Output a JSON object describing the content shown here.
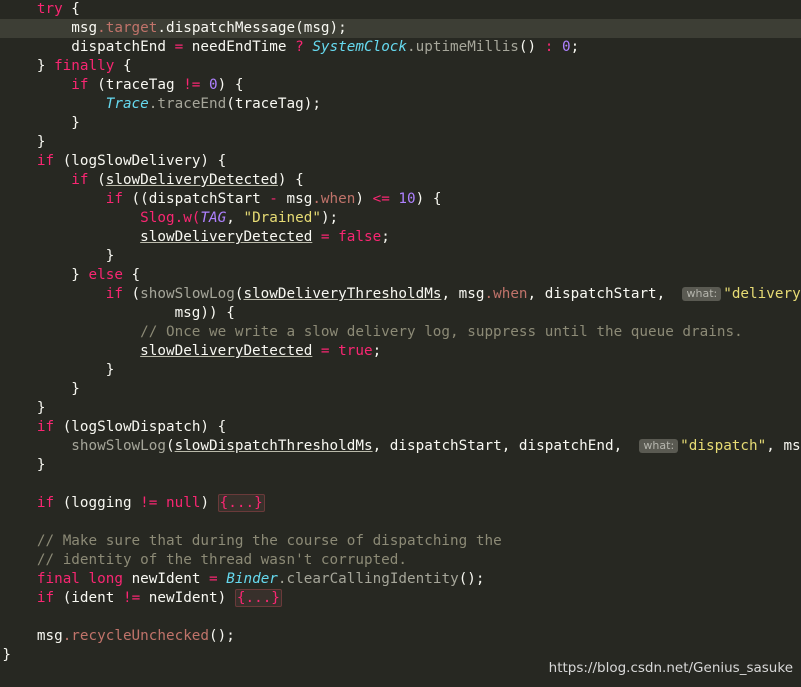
{
  "editor": {
    "language": "Java",
    "colors": {
      "background": "#272822",
      "current_line": "#3d3e35",
      "keyword": "#f92672",
      "number": "#ae81ff",
      "string": "#e6db74",
      "class": "#66d9ef",
      "comment": "#8c8a76",
      "text": "#f8f8f2"
    },
    "lines": [
      {
        "current": false,
        "tokens": [
          {
            "t": "        "
          },
          {
            "t": "try",
            "c": "kw"
          },
          {
            "t": " {"
          }
        ]
      },
      {
        "current": true,
        "tokens": [
          {
            "t": "            msg"
          },
          {
            "t": ".target",
            "c": "mcall"
          },
          {
            "t": ".dispatchMessage(msg);"
          }
        ]
      },
      {
        "current": false,
        "tokens": [
          {
            "t": "            dispatchEnd "
          },
          {
            "t": "=",
            "c": "kw"
          },
          {
            "t": " needEndTime "
          },
          {
            "t": "?",
            "c": "kw"
          },
          {
            "t": " "
          },
          {
            "t": "SystemClock",
            "c": "cls"
          },
          {
            "t": ".uptimeMillis",
            "c": "meth"
          },
          {
            "t": "() "
          },
          {
            "t": ":",
            "c": "kw"
          },
          {
            "t": " "
          },
          {
            "t": "0",
            "c": "num"
          },
          {
            "t": ";"
          }
        ]
      },
      {
        "current": false,
        "tokens": [
          {
            "t": "        } "
          },
          {
            "t": "finally",
            "c": "kw"
          },
          {
            "t": " {"
          }
        ]
      },
      {
        "current": false,
        "tokens": [
          {
            "t": "            "
          },
          {
            "t": "if",
            "c": "kw"
          },
          {
            "t": " (traceTag "
          },
          {
            "t": "!=",
            "c": "kw"
          },
          {
            "t": " "
          },
          {
            "t": "0",
            "c": "num"
          },
          {
            "t": ") {"
          }
        ]
      },
      {
        "current": false,
        "tokens": [
          {
            "t": "                "
          },
          {
            "t": "Trace",
            "c": "cls"
          },
          {
            "t": ".traceEnd",
            "c": "meth"
          },
          {
            "t": "(traceTag);"
          }
        ]
      },
      {
        "current": false,
        "tokens": [
          {
            "t": "            }"
          }
        ]
      },
      {
        "current": false,
        "tokens": [
          {
            "t": "        }"
          }
        ]
      },
      {
        "current": false,
        "tokens": [
          {
            "t": "        "
          },
          {
            "t": "if",
            "c": "kw"
          },
          {
            "t": " (logSlowDelivery) {"
          }
        ]
      },
      {
        "current": false,
        "tokens": [
          {
            "t": "            "
          },
          {
            "t": "if",
            "c": "kw"
          },
          {
            "t": " ("
          },
          {
            "t": "slowDeliveryDetected",
            "c": "ul"
          },
          {
            "t": ") {"
          }
        ]
      },
      {
        "current": false,
        "tokens": [
          {
            "t": "                "
          },
          {
            "t": "if",
            "c": "kw"
          },
          {
            "t": " ((dispatchStart "
          },
          {
            "t": "-",
            "c": "kw"
          },
          {
            "t": " msg"
          },
          {
            "t": ".when",
            "c": "mcall"
          },
          {
            "t": ") "
          },
          {
            "t": "<=",
            "c": "kw"
          },
          {
            "t": " "
          },
          {
            "t": "10",
            "c": "num"
          },
          {
            "t": ") {"
          }
        ]
      },
      {
        "current": false,
        "tokens": [
          {
            "t": "                    "
          },
          {
            "t": "Slog",
            "c": "kw"
          },
          {
            "t": ".w(",
            "c": "kw"
          },
          {
            "t": "TAG",
            "c": "const"
          },
          {
            "t": ", "
          },
          {
            "t": "\"Drained\"",
            "c": "str"
          },
          {
            "t": ");"
          }
        ]
      },
      {
        "current": false,
        "tokens": [
          {
            "t": "                    "
          },
          {
            "t": "slowDeliveryDetected",
            "c": "ul"
          },
          {
            "t": " "
          },
          {
            "t": "=",
            "c": "kw"
          },
          {
            "t": " "
          },
          {
            "t": "false",
            "c": "kw"
          },
          {
            "t": ";"
          }
        ]
      },
      {
        "current": false,
        "tokens": [
          {
            "t": "                }"
          }
        ]
      },
      {
        "current": false,
        "tokens": [
          {
            "t": "            } "
          },
          {
            "t": "else",
            "c": "kw"
          },
          {
            "t": " {"
          }
        ]
      },
      {
        "current": false,
        "tokens": [
          {
            "t": "                "
          },
          {
            "t": "if",
            "c": "kw"
          },
          {
            "t": " ("
          },
          {
            "t": "showSlowLog",
            "c": "meth"
          },
          {
            "t": "("
          },
          {
            "t": "slowDeliveryThresholdMs",
            "c": "ul"
          },
          {
            "t": ", msg"
          },
          {
            "t": ".when",
            "c": "mcall"
          },
          {
            "t": ", dispatchStart,  "
          },
          {
            "t": "what:",
            "c": "hint"
          },
          {
            "t": "\"delivery\"",
            "c": "str"
          },
          {
            "t": ","
          }
        ]
      },
      {
        "current": false,
        "tokens": [
          {
            "t": "                        msg)) {"
          }
        ]
      },
      {
        "current": false,
        "tokens": [
          {
            "t": "                    "
          },
          {
            "t": "// Once we write a slow delivery log, suppress until the queue drains.",
            "c": "cmt"
          }
        ]
      },
      {
        "current": false,
        "tokens": [
          {
            "t": "                    "
          },
          {
            "t": "slowDeliveryDetected",
            "c": "ul"
          },
          {
            "t": " "
          },
          {
            "t": "=",
            "c": "kw"
          },
          {
            "t": " "
          },
          {
            "t": "true",
            "c": "kw"
          },
          {
            "t": ";"
          }
        ]
      },
      {
        "current": false,
        "tokens": [
          {
            "t": "                }"
          }
        ]
      },
      {
        "current": false,
        "tokens": [
          {
            "t": "            }"
          }
        ]
      },
      {
        "current": false,
        "tokens": [
          {
            "t": "        }"
          }
        ]
      },
      {
        "current": false,
        "tokens": [
          {
            "t": "        "
          },
          {
            "t": "if",
            "c": "kw"
          },
          {
            "t": " (logSlowDispatch) {"
          }
        ]
      },
      {
        "current": false,
        "tokens": [
          {
            "t": "            "
          },
          {
            "t": "showSlowLog",
            "c": "meth"
          },
          {
            "t": "("
          },
          {
            "t": "slowDispatchThresholdMs",
            "c": "ul"
          },
          {
            "t": ", dispatchStart, dispatchEnd,  "
          },
          {
            "t": "what:",
            "c": "hint"
          },
          {
            "t": "\"dispatch\"",
            "c": "str"
          },
          {
            "t": ", msg);"
          }
        ]
      },
      {
        "current": false,
        "tokens": [
          {
            "t": "        }"
          }
        ]
      },
      {
        "current": false,
        "tokens": [
          {
            "t": ""
          }
        ]
      },
      {
        "current": false,
        "tokens": [
          {
            "t": "        "
          },
          {
            "t": "if",
            "c": "kw"
          },
          {
            "t": " (logging "
          },
          {
            "t": "!=",
            "c": "kw"
          },
          {
            "t": " "
          },
          {
            "t": "null",
            "c": "kw"
          },
          {
            "t": ") "
          },
          {
            "t": "{...}",
            "c": "fold"
          }
        ]
      },
      {
        "current": false,
        "tokens": [
          {
            "t": ""
          }
        ]
      },
      {
        "current": false,
        "tokens": [
          {
            "t": "        "
          },
          {
            "t": "// Make sure that during the course of dispatching the",
            "c": "cmt"
          }
        ]
      },
      {
        "current": false,
        "tokens": [
          {
            "t": "        "
          },
          {
            "t": "// identity of the thread wasn't corrupted.",
            "c": "cmt"
          }
        ]
      },
      {
        "current": false,
        "tokens": [
          {
            "t": "        "
          },
          {
            "t": "final",
            "c": "kw"
          },
          {
            "t": " "
          },
          {
            "t": "long",
            "c": "kw"
          },
          {
            "t": " newIdent "
          },
          {
            "t": "=",
            "c": "kw"
          },
          {
            "t": " "
          },
          {
            "t": "Binder",
            "c": "cls"
          },
          {
            "t": ".clearCallingIdentity",
            "c": "meth"
          },
          {
            "t": "();"
          }
        ]
      },
      {
        "current": false,
        "tokens": [
          {
            "t": "        "
          },
          {
            "t": "if",
            "c": "kw"
          },
          {
            "t": " (ident "
          },
          {
            "t": "!=",
            "c": "kw"
          },
          {
            "t": " newIdent) "
          },
          {
            "t": "{...}",
            "c": "fold"
          }
        ]
      },
      {
        "current": false,
        "tokens": [
          {
            "t": ""
          }
        ]
      },
      {
        "current": false,
        "tokens": [
          {
            "t": "        msg"
          },
          {
            "t": ".recycleUnchecked",
            "c": "mcall"
          },
          {
            "t": "();"
          }
        ]
      },
      {
        "current": false,
        "tokens": [
          {
            "t": "    }"
          }
        ]
      },
      {
        "current": false,
        "tokens": [
          {
            "t": "}"
          }
        ]
      }
    ]
  },
  "watermark": "https://blog.csdn.net/Genius_sasuke"
}
